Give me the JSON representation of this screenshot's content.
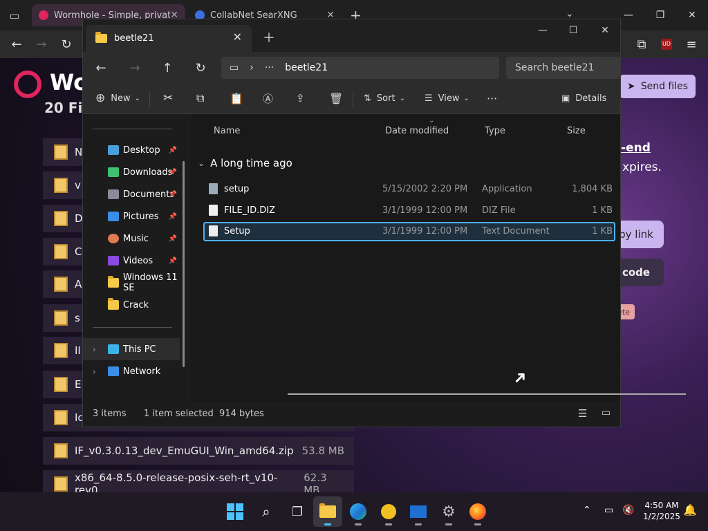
{
  "browser": {
    "tabs": [
      {
        "title": "Wormhole - Simple, private file"
      },
      {
        "title": "CollabNet SearXNG"
      }
    ],
    "new_tab_symbol": "+",
    "extension_badge": "UD"
  },
  "webpage": {
    "title": "Wo",
    "subtitle": "20 Fi",
    "send_files": "Send files",
    "right_text_1": "-end",
    "right_text_2": "xpires.",
    "copy_link": "py link",
    "qr_code": "code",
    "delete": "ete",
    "files": [
      {
        "name": "N",
        "size": ""
      },
      {
        "name": "v",
        "size": ""
      },
      {
        "name": "D",
        "size": ""
      },
      {
        "name": "C",
        "size": ""
      },
      {
        "name": "A",
        "size": ""
      },
      {
        "name": "s",
        "size": ""
      },
      {
        "name": "II",
        "size": ""
      },
      {
        "name": "E",
        "size": ""
      },
      {
        "name": "Ic",
        "size": ""
      },
      {
        "name": "IF_v0.3.0.13_dev_EmuGUI_Win_amd64.zip",
        "size": "53.8 MB"
      },
      {
        "name": "x86_64-8.5.0-release-posix-seh-rt_v10-rev0....",
        "size": "62.3 MB"
      }
    ]
  },
  "explorer": {
    "tab_title": "beetle21",
    "address": "beetle21",
    "address_ellipsis": "···",
    "search_placeholder": "Search beetle21",
    "commands": {
      "new": "New",
      "sort": "Sort",
      "view": "View",
      "more": "···",
      "details": "Details"
    },
    "nav": [
      {
        "label": "Desktop",
        "pinned": true,
        "color": "#4a9fe0"
      },
      {
        "label": "Downloads",
        "pinned": true,
        "color": "#3fbf6f"
      },
      {
        "label": "Documents",
        "pinned": true,
        "color": "#8a8a9a"
      },
      {
        "label": "Pictures",
        "pinned": true,
        "color": "#3b8ee8"
      },
      {
        "label": "Music",
        "pinned": true,
        "color": "#e07a50"
      },
      {
        "label": "Videos",
        "pinned": true,
        "color": "#8a4ae0"
      },
      {
        "label": "Windows 11 SE",
        "pinned": false,
        "color": "#f7c948"
      },
      {
        "label": "Crack",
        "pinned": false,
        "color": "#f7c948"
      }
    ],
    "nav_bottom": [
      {
        "label": "This PC"
      },
      {
        "label": "Network"
      }
    ],
    "columns": {
      "name": "Name",
      "date": "Date modified",
      "type": "Type",
      "size": "Size"
    },
    "group": "A long time ago",
    "files": [
      {
        "name": "setup",
        "date": "5/15/2002 2:20 PM",
        "type": "Application",
        "size": "1,804 KB",
        "selected": false
      },
      {
        "name": "FILE_ID.DIZ",
        "date": "3/1/1999 12:00 PM",
        "type": "DIZ File",
        "size": "1 KB",
        "selected": false
      },
      {
        "name": "Setup",
        "date": "3/1/1999 12:00 PM",
        "type": "Text Document",
        "size": "1 KB",
        "selected": true
      }
    ],
    "status": {
      "items": "3 items",
      "selection": "1 item selected  914 bytes"
    }
  },
  "taskbar": {
    "time": "4:50 AM",
    "date": "1/2/2025"
  }
}
